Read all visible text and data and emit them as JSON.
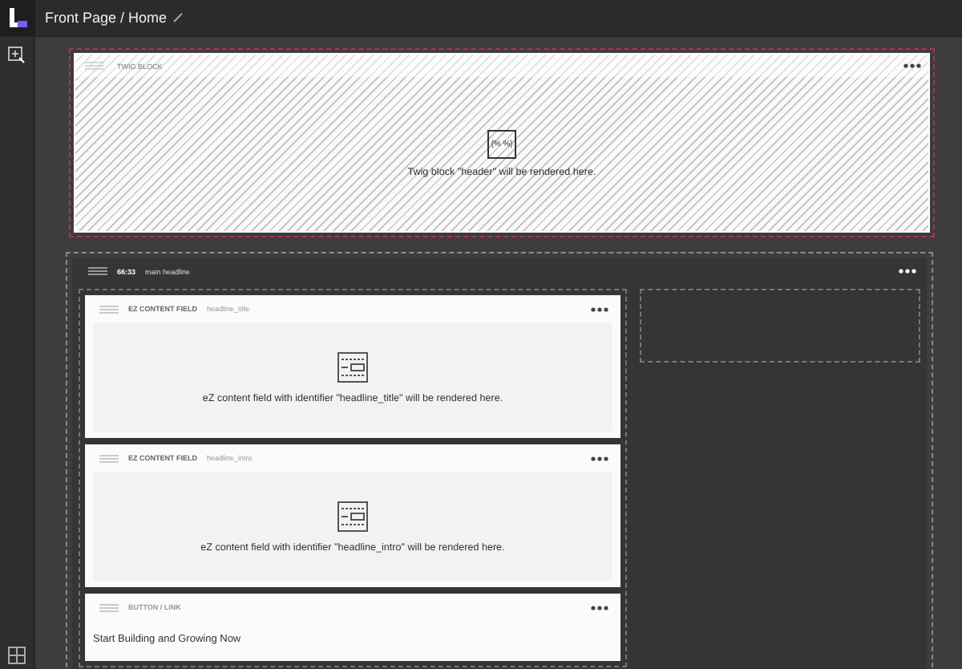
{
  "topbar": {
    "title": "Front Page / Home"
  },
  "twig_block": {
    "label": "TWIG BLOCK",
    "icon_text": "{% %}",
    "message": "Twig block \"header\" will be rendered here."
  },
  "section": {
    "code": "66:33",
    "name": "main headline",
    "blocks": [
      {
        "kind": "field",
        "type": "EZ CONTENT FIELD",
        "identifier": "headline_title",
        "message": "eZ content field with identifier \"headline_title\" will be rendered here."
      },
      {
        "kind": "field",
        "type": "EZ CONTENT FIELD",
        "identifier": "headline_intro",
        "message": "eZ content field with identifier \"headline_intro\" will be rendered here."
      },
      {
        "kind": "link",
        "type": "BUTTON / LINK",
        "text": "Start Building and Growing Now"
      }
    ]
  }
}
